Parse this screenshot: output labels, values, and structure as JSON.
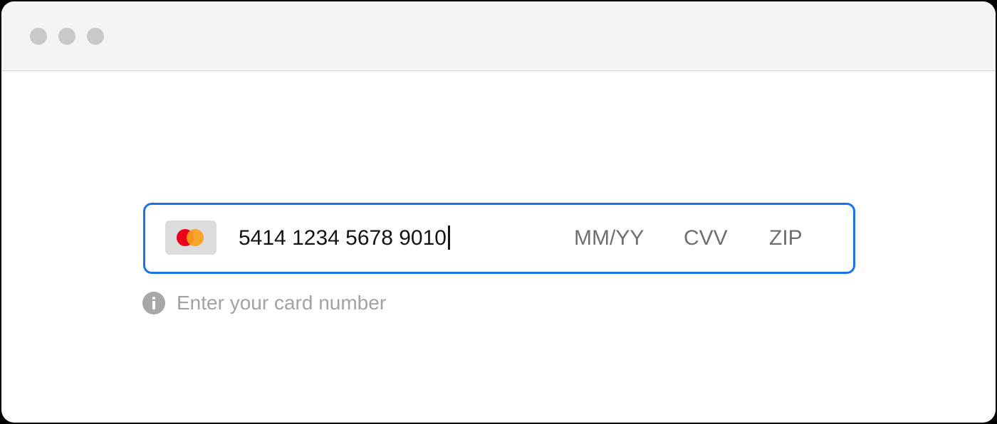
{
  "window": {
    "controls": [
      "close-dot",
      "minimize-dot",
      "zoom-dot"
    ]
  },
  "payment": {
    "brand": "mastercard",
    "card_number": "5414 1234 5678 9010",
    "expiry_placeholder": "MM/YY",
    "cvv_placeholder": "CVV",
    "zip_placeholder": "ZIP",
    "helper_text": "Enter your card number"
  },
  "colors": {
    "focus_border": "#1a73e8",
    "mastercard_red": "#eb001b",
    "mastercard_orange": "#f79e1b",
    "helper_text": "#a3a3a3",
    "placeholder_text": "#6f6f6f"
  },
  "icons": {
    "brand": "mastercard-icon",
    "helper": "info-icon"
  }
}
